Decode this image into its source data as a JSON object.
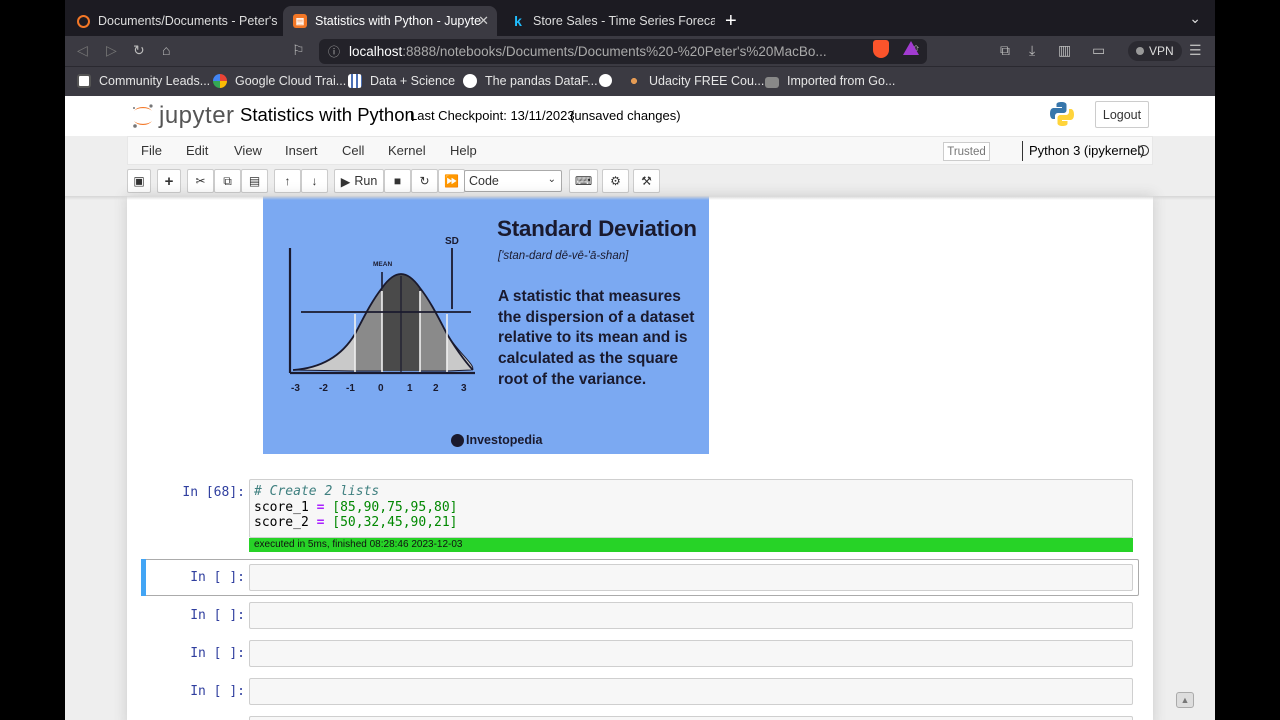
{
  "browser": {
    "tabs": [
      {
        "title": "Documents/Documents - Peter's M",
        "active": false
      },
      {
        "title": "Statistics with Python - Jupyte",
        "active": true
      },
      {
        "title": "Store Sales - Time Series Forecasti",
        "active": false
      }
    ],
    "url_host": "localhost",
    "url_path": ":8888/notebooks/Documents/Documents%20-%20Peter's%20MacBo...",
    "vpn_label": "VPN",
    "bookmarks": [
      "Community Leads...",
      "Google Cloud Trai...",
      "Data + Science",
      "The pandas DataF...",
      "Udacity FREE Cou...",
      "Imported from Go..."
    ]
  },
  "jupyter": {
    "logo_text": "jupyter",
    "notebook_title": "Statistics with Python",
    "checkpoint": "Last Checkpoint: 13/11/2023",
    "unsaved": "(unsaved changes)",
    "logout": "Logout",
    "menu": [
      "File",
      "Edit",
      "View",
      "Insert",
      "Cell",
      "Kernel",
      "Help"
    ],
    "trusted": "Trusted",
    "kernel": "Python 3 (ipykernel)",
    "run_label": "Run",
    "cell_type": "Code"
  },
  "image": {
    "title": "Standard Deviation",
    "phonetic": "['stan-dard dē-vē-'ā-shan]",
    "description": "A statistic that measures the dispersion of a dataset relative to its mean and is calculated as the square root of the variance.",
    "mean_label": "MEAN",
    "sd_label": "SD",
    "axis_ticks": [
      "-3",
      "-2",
      "-1",
      "0",
      "1",
      "2",
      "3"
    ],
    "brand": "Investopedia"
  },
  "cells": {
    "executed": {
      "prompt": "In [68]:",
      "comment": "# Create 2 lists",
      "line1_var": "score_1",
      "line1_vals": "[85,90,75,95,80]",
      "line2_var": "score_2",
      "line2_vals": "[50,32,45,90,21]",
      "exec_info": "executed in 5ms, finished 08:28:46 2023-12-03"
    },
    "empty_prompt": "In [ ]:"
  },
  "colors": {
    "exec_bar": "#27d327",
    "selected_cell_bar": "#42a5f5",
    "image_bg": "#7ba9f2"
  }
}
